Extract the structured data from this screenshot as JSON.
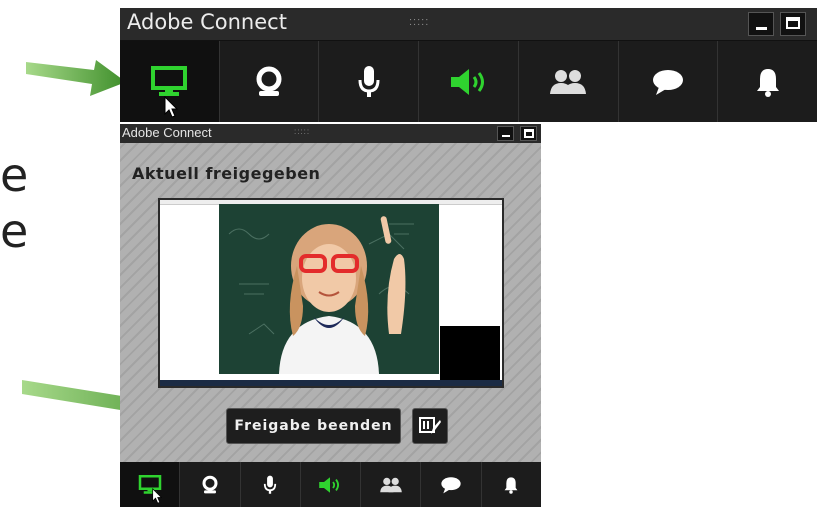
{
  "main_window": {
    "title": "Adobe Connect",
    "toolbar": [
      {
        "name": "share-screen",
        "icon": "monitor-icon",
        "active": true
      },
      {
        "name": "webcam",
        "icon": "webcam-icon"
      },
      {
        "name": "microphone",
        "icon": "microphone-icon"
      },
      {
        "name": "speaker",
        "icon": "speaker-icon",
        "active": true
      },
      {
        "name": "attendees",
        "icon": "people-icon"
      },
      {
        "name": "chat",
        "icon": "chat-bubble-icon"
      },
      {
        "name": "notifications",
        "icon": "bell-icon"
      }
    ]
  },
  "background_text": {
    "line1": "e",
    "line2": "e"
  },
  "share_window": {
    "title": "Adobe Connect",
    "heading": "Aktuell freigegeben",
    "stop_button": "Freigabe beenden",
    "edit_icon": "annotate-icon"
  },
  "colors": {
    "accent_green": "#2fd32f",
    "toolbar_bg": "#1c1c1c",
    "arrow_green": "#5fae3b"
  }
}
